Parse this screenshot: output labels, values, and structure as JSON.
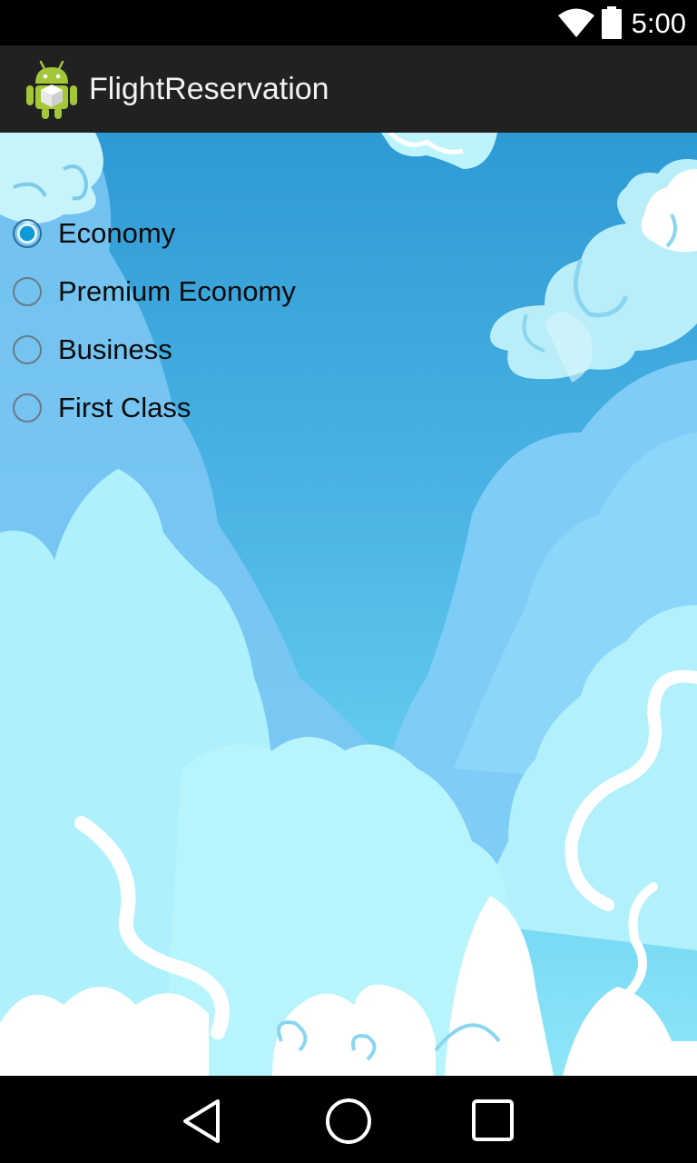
{
  "status_bar": {
    "time": "5:00",
    "icons": [
      "wifi-icon",
      "battery-icon"
    ]
  },
  "action_bar": {
    "app_icon": "android-icon",
    "title": "FlightReservation"
  },
  "radio_group": {
    "options": [
      {
        "label": "Economy",
        "checked": true
      },
      {
        "label": "Premium Economy",
        "checked": false
      },
      {
        "label": "Business",
        "checked": false
      },
      {
        "label": "First Class",
        "checked": false
      }
    ]
  },
  "nav_bar": {
    "buttons": [
      "back-icon",
      "home-icon",
      "recents-icon"
    ]
  },
  "colors": {
    "sky_top": "#2f9fd8",
    "sky_mid": "#5cc7ee",
    "cloud_light": "#a6f5fb",
    "cloud_white": "#ffffff",
    "radio_accent": "#0b9bd6",
    "action_bar": "#212121"
  }
}
